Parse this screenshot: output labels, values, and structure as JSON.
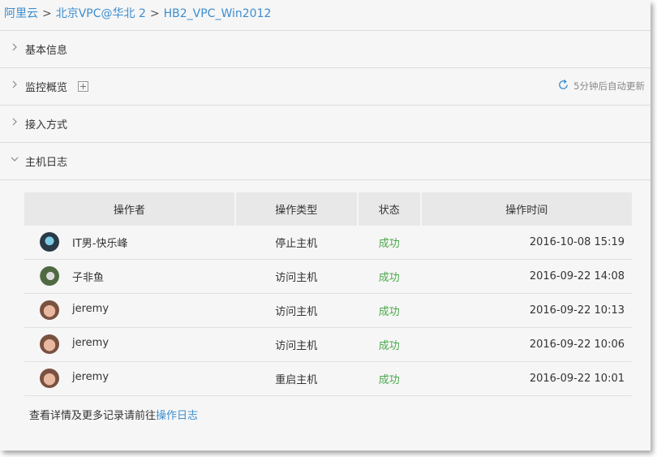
{
  "breadcrumb": {
    "items": [
      "阿里云",
      "北京VPC@华北 2",
      "HB2_VPC_Win2012"
    ],
    "separator": ">"
  },
  "sections": {
    "basic_info": "基本信息",
    "monitor": "监控概览",
    "access": "接入方式",
    "host_log": "主机日志"
  },
  "refresh": {
    "text": "5分钟后自动更新",
    "icon": "refresh-icon"
  },
  "log_table": {
    "headers": [
      "操作者",
      "操作类型",
      "状态",
      "操作时间"
    ],
    "rows": [
      {
        "operator": "IT男-快乐峰",
        "type": "停止主机",
        "status": "成功",
        "time": "2016-10-08 15:19"
      },
      {
        "operator": "子非鱼",
        "type": "访问主机",
        "status": "成功",
        "time": "2016-09-22 14:08"
      },
      {
        "operator": "jeremy",
        "type": "访问主机",
        "status": "成功",
        "time": "2016-09-22 10:13"
      },
      {
        "operator": "jeremy",
        "type": "访问主机",
        "status": "成功",
        "time": "2016-09-22 10:06"
      },
      {
        "operator": "jeremy",
        "type": "重启主机",
        "status": "成功",
        "time": "2016-09-22 10:01"
      }
    ]
  },
  "footer": {
    "text": "查看详情及更多记录请前往",
    "link": "操作日志"
  },
  "colors": {
    "link": "#3c8dcf",
    "success": "#4aa84a",
    "header_bg": "#e8e8e8"
  }
}
